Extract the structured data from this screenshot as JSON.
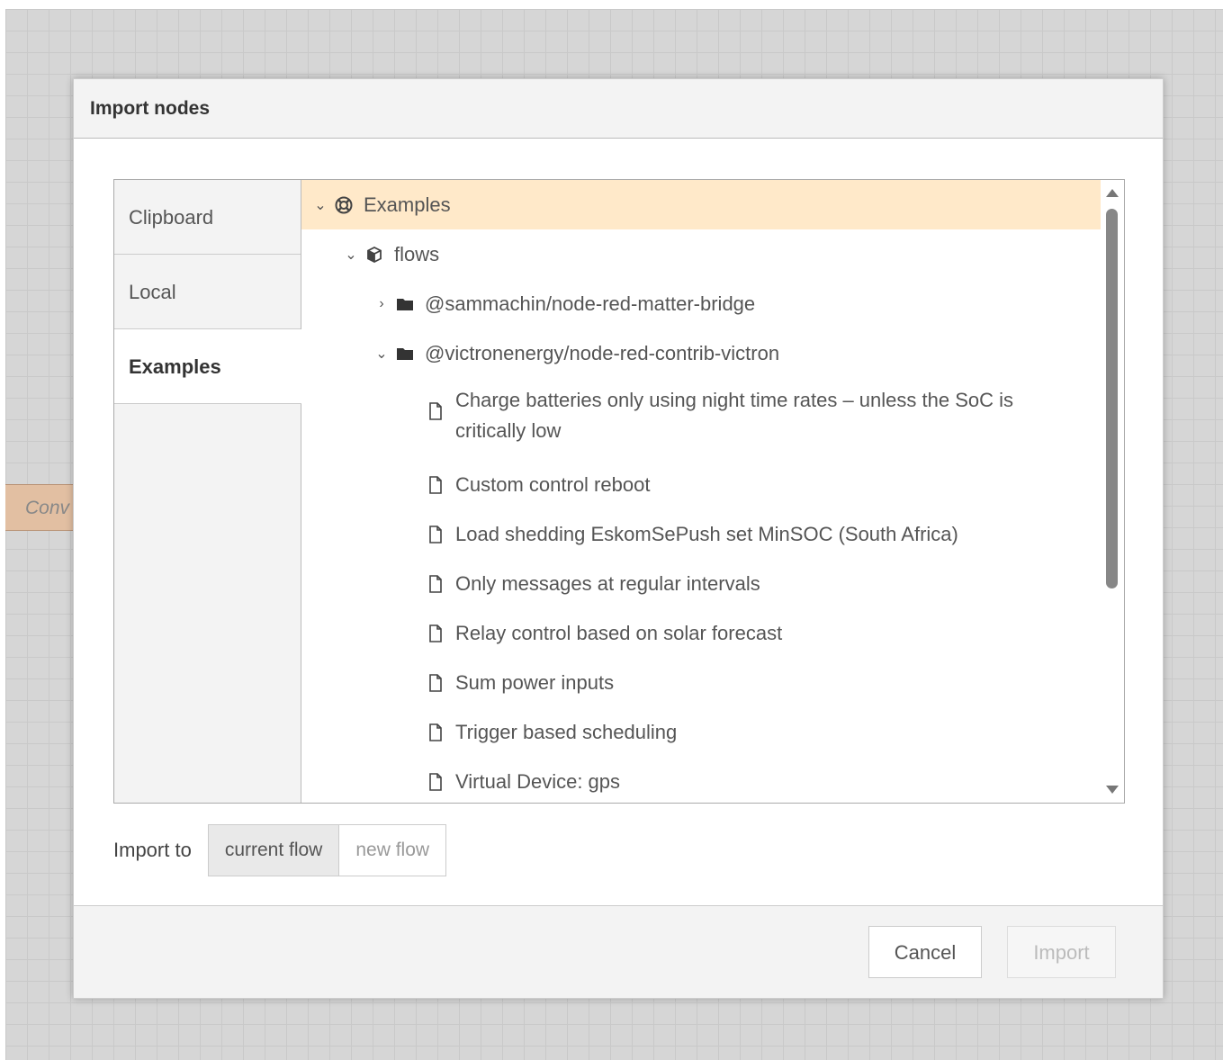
{
  "canvas": {
    "node_label": "Conv"
  },
  "dialog": {
    "title": "Import nodes",
    "tabs": [
      {
        "label": "Clipboard"
      },
      {
        "label": "Local"
      },
      {
        "label": "Examples"
      }
    ],
    "tree": {
      "root": {
        "label": "Examples",
        "icon": "lifebuoy-icon"
      },
      "flows": {
        "label": "flows",
        "icon": "cube-icon"
      },
      "folders": [
        {
          "label": "@sammachin/node-red-matter-bridge",
          "icon": "folder-icon",
          "expanded": false
        },
        {
          "label": "@victronenergy/node-red-contrib-victron",
          "icon": "folder-icon",
          "expanded": true
        }
      ],
      "files": [
        "Charge batteries only using night time rates – unless the SoC is critically low",
        "Custom control reboot",
        "Load shedding EskomSePush set MinSOC (South Africa)",
        "Only messages at regular intervals",
        "Relay control based on solar forecast",
        "Sum power inputs",
        "Trigger based scheduling",
        "Virtual Device: gps"
      ]
    },
    "import_to": {
      "label": "Import to",
      "options": [
        "current flow",
        "new flow"
      ],
      "selected": "current flow"
    },
    "buttons": {
      "cancel": "Cancel",
      "import": "Import"
    }
  }
}
